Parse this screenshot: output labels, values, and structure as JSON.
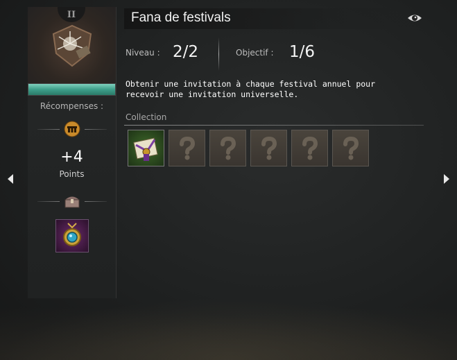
{
  "achievement": {
    "tier": "II",
    "title": "Fana de festivals",
    "progress_fraction": 1.0,
    "rewards_label": "Récompenses :",
    "points_value": "+4",
    "points_label": "Points",
    "level_label": "Niveau :",
    "level_value": "2/2",
    "objective_label": "Objectif :",
    "objective_value": "1/6",
    "description": "Obtenir une invitation à chaque festival annuel pour recevoir une invitation universelle.",
    "collection_label": "Collection"
  },
  "collection": {
    "slots": [
      {
        "state": "unlocked",
        "icon": "festival-invitation-icon"
      },
      {
        "state": "locked",
        "icon": "question-mark-icon"
      },
      {
        "state": "locked",
        "icon": "question-mark-icon"
      },
      {
        "state": "locked",
        "icon": "question-mark-icon"
      },
      {
        "state": "locked",
        "icon": "question-mark-icon"
      },
      {
        "state": "locked",
        "icon": "question-mark-icon"
      }
    ]
  },
  "colors": {
    "progress_fill": "#3e9f8a",
    "accent_gold": "#c98a2a"
  },
  "icons": {
    "prev": "chevron-left-icon",
    "next": "chevron-right-icon",
    "watch": "eye-icon",
    "points": "achievement-points-icon",
    "chest": "chest-icon",
    "reward_item": "amulet-icon"
  }
}
